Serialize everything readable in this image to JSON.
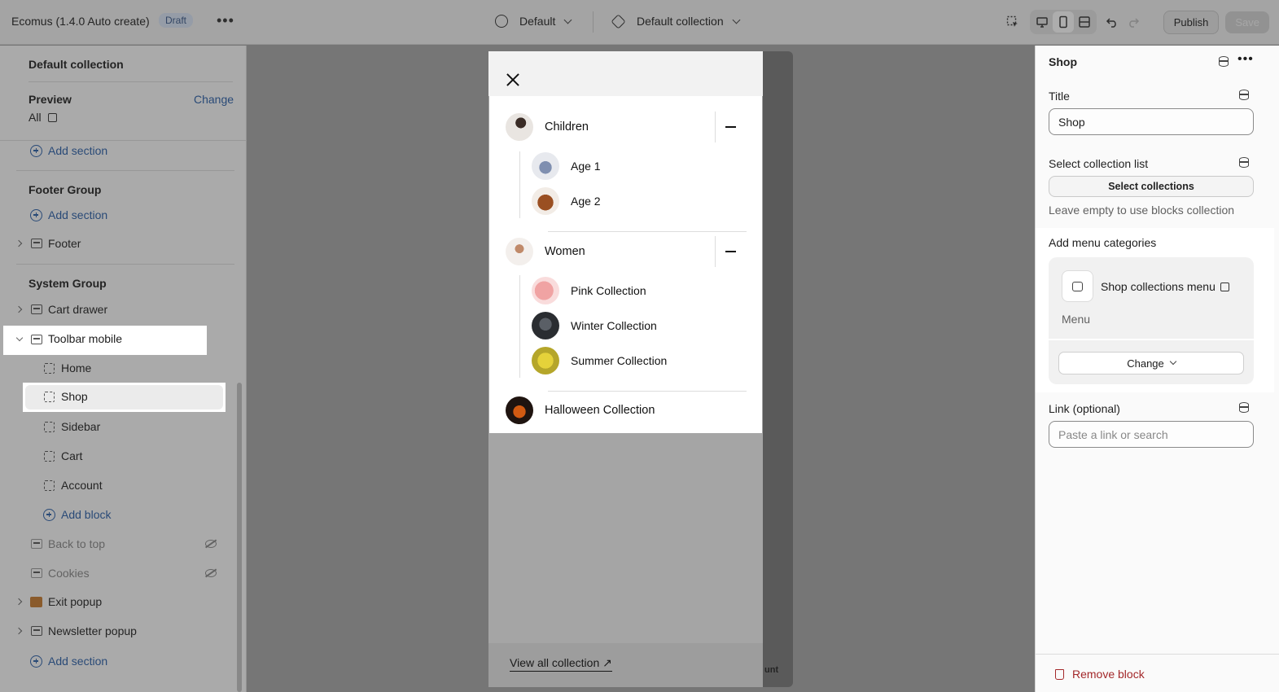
{
  "topbar": {
    "app_title": "Ecomus (1.4.0 Auto create)",
    "status_badge": "Draft",
    "more_label": "•••",
    "theme_selector": "Default",
    "template_selector": "Default collection",
    "publish_label": "Publish",
    "save_label": "Save"
  },
  "left_panel": {
    "header": "Default collection",
    "preview_label": "Preview",
    "preview_change": "Change",
    "preview_value": "All",
    "add_section": "Add section",
    "footer_group": {
      "title": "Footer Group",
      "add_section": "Add section",
      "items": [
        "Footer"
      ]
    },
    "system_group": {
      "title": "System Group",
      "items": [
        {
          "label": "Cart drawer"
        },
        {
          "label": "Toolbar mobile"
        }
      ],
      "toolbar_blocks": [
        "Home",
        "Shop",
        "Sidebar",
        "Cart",
        "Account"
      ],
      "add_block": "Add block",
      "hidden_items": [
        "Back to top",
        "Cookies"
      ],
      "more_items": [
        "Exit popup",
        "Newsletter popup"
      ],
      "add_section": "Add section"
    }
  },
  "menu": {
    "items": [
      {
        "label": "Children",
        "children": [
          "Age 1",
          "Age 2"
        ]
      },
      {
        "label": "Women",
        "children": [
          "Pink Collection",
          "Winter Collection",
          "Summer Collection"
        ]
      },
      {
        "label": "Halloween Collection"
      }
    ],
    "view_all": "View all collection ↗",
    "peek_text": "unt"
  },
  "right_panel": {
    "block_title": "Shop",
    "title_label": "Title",
    "title_value": "Shop",
    "collection_list_label": "Select collection list",
    "select_collections": "Select collections",
    "collection_hint": "Leave empty to use blocks collection",
    "menu_categories_label": "Add menu categories",
    "menu_name": "Shop collections menu",
    "menu_type": "Menu",
    "change_label": "Change",
    "link_label": "Link (optional)",
    "link_placeholder": "Paste a link or search",
    "remove_block": "Remove block"
  },
  "colors": {
    "link_blue": "#2b5fa8",
    "danger_red": "#a3282a",
    "badge_bg": "#d9e4f5"
  }
}
